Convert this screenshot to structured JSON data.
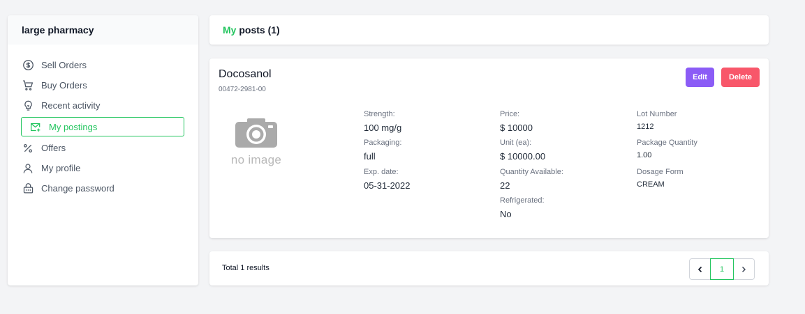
{
  "sidebar": {
    "title": "large pharmacy",
    "items": [
      {
        "label": "Sell Orders",
        "icon": "dollar-circle-icon"
      },
      {
        "label": "Buy Orders",
        "icon": "cart-icon"
      },
      {
        "label": "Recent activity",
        "icon": "lightbulb-icon"
      },
      {
        "label": "My postings",
        "icon": "mail-post-icon",
        "active": true
      },
      {
        "label": "Offers",
        "icon": "percent-icon"
      },
      {
        "label": "My profile",
        "icon": "user-icon"
      },
      {
        "label": "Change password",
        "icon": "lock-icon"
      }
    ]
  },
  "header": {
    "accent": "My",
    "title_rest": "posts (1)"
  },
  "post": {
    "name": "Docosanol",
    "ndc": "00472-2981-00",
    "edit_label": "Edit",
    "delete_label": "Delete",
    "image_placeholder": "no image",
    "fields": {
      "strength": {
        "label": "Strength:",
        "value": "100 mg/g"
      },
      "packaging": {
        "label": "Packaging:",
        "value": "full"
      },
      "exp_date": {
        "label": "Exp. date:",
        "value": "05-31-2022"
      },
      "price": {
        "label": "Price:",
        "value": "$ 10000"
      },
      "unit": {
        "label": "Unit (ea):",
        "value": "$ 10000.00"
      },
      "qty_available": {
        "label": "Quantity Available:",
        "value": "22"
      },
      "refrigerated": {
        "label": "Refrigerated:",
        "value": "No"
      },
      "lot": {
        "label": "Lot Number",
        "value": "1212"
      },
      "pkg_qty": {
        "label": "Package Quantity",
        "value": "1.00"
      },
      "dosage": {
        "label": "Dosage Form",
        "value": "CREAM"
      }
    }
  },
  "footer": {
    "total": "Total 1 results",
    "current_page": "1"
  },
  "colors": {
    "accent": "#22c55e",
    "edit": "#8b5cf6",
    "delete": "#f8576a"
  }
}
